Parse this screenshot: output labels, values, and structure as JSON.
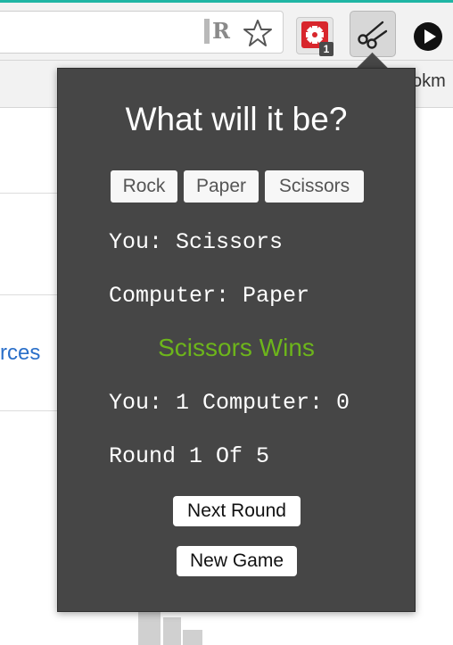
{
  "browser": {
    "accent_color": "#1fb5a4",
    "extensions": [
      {
        "name": "readability-r",
        "glyph": "R"
      },
      {
        "name": "bookmark-star"
      },
      {
        "name": "red-extension",
        "badge": "1"
      },
      {
        "name": "scissors-extension"
      },
      {
        "name": "play-extension"
      }
    ],
    "bookmark_fragment": "okm"
  },
  "page": {
    "link_fragment": "rces",
    "link_color": "#2a6fc9"
  },
  "popup": {
    "background": "#464646",
    "title": "What will it be?",
    "choices": [
      "Rock",
      "Paper",
      "Scissors"
    ],
    "you_line": "You: Scissors",
    "computer_line": "Computer: Paper",
    "result": "Scissors Wins",
    "result_color": "#6db51b",
    "score_line": "You: 1 Computer: 0",
    "round_line": "Round 1 Of 5",
    "next_round_label": "Next Round",
    "new_game_label": "New Game"
  }
}
